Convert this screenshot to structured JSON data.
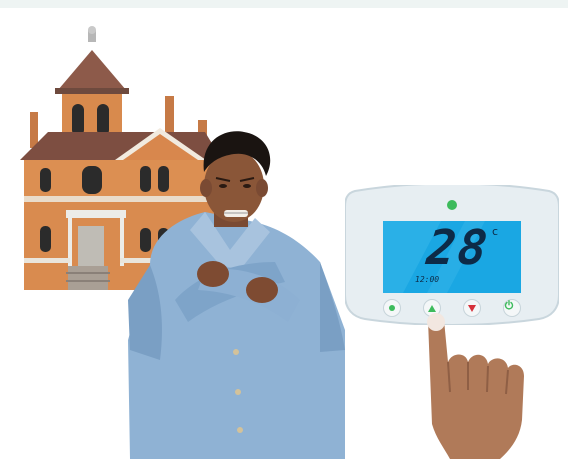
{
  "scene": {
    "background": "#ffffff",
    "top_band_color": "#eef4f3"
  },
  "thermostat": {
    "temperature": "28",
    "unit": "c",
    "time": "12:00",
    "indicator_color": "#3dbb5c",
    "screen_color": "#1aa7e3",
    "buttons": [
      {
        "icon": "dot-icon",
        "color": "#3dbb5c"
      },
      {
        "icon": "arrow-up-icon",
        "color": "#3dbb5c"
      },
      {
        "icon": "arrow-down-icon",
        "color": "#d6303a"
      },
      {
        "icon": "power-icon",
        "color": "#3dbb5c"
      }
    ]
  },
  "illustration": {
    "house": "victorian-brick-house",
    "person": "shivering-man-in-denim-jacket",
    "hand": "pointing-finger-pressing-button"
  }
}
